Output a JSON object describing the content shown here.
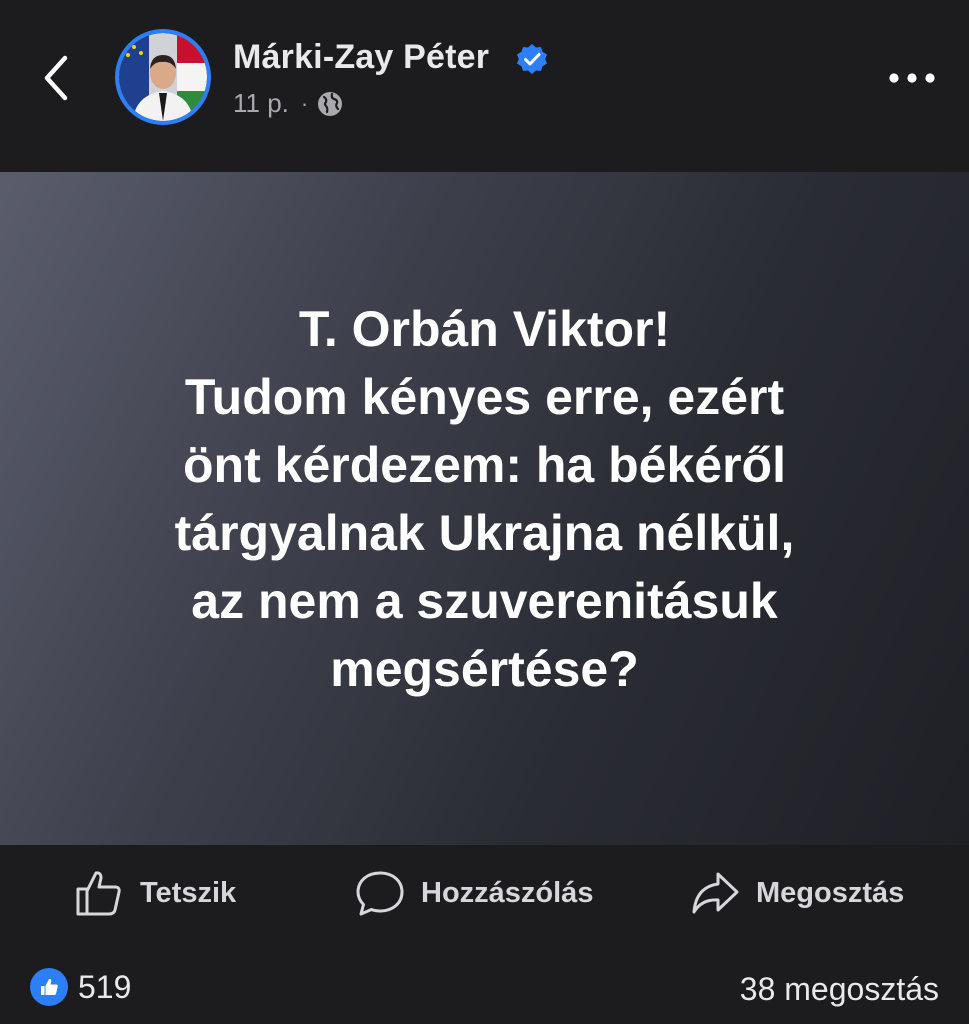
{
  "header": {
    "author_name": "Márki-Zay Péter",
    "time": "11 p.",
    "separator": "·",
    "icons": {
      "back": "chevron-left-icon",
      "verified": "verified-badge-icon",
      "audience": "globe-icon",
      "more": "more-horizontal-icon"
    }
  },
  "post": {
    "lines": [
      "T. Orbán Viktor!",
      "Tudom kényes erre, ezért",
      "önt kérdezem: ha békéről",
      "tárgyalnak Ukrajna nélkül,",
      "az nem a szuverenitásuk",
      "megsértése?"
    ]
  },
  "actions": {
    "like_label": "Tetszik",
    "comment_label": "Hozzászólás",
    "share_label": "Megosztás"
  },
  "stats": {
    "reactions": "519",
    "shares": "38 megosztás"
  },
  "colors": {
    "accent": "#2d7ff9",
    "background": "#1c1c1e",
    "text_primary": "#ffffff",
    "text_secondary": "#a8a8ad"
  }
}
